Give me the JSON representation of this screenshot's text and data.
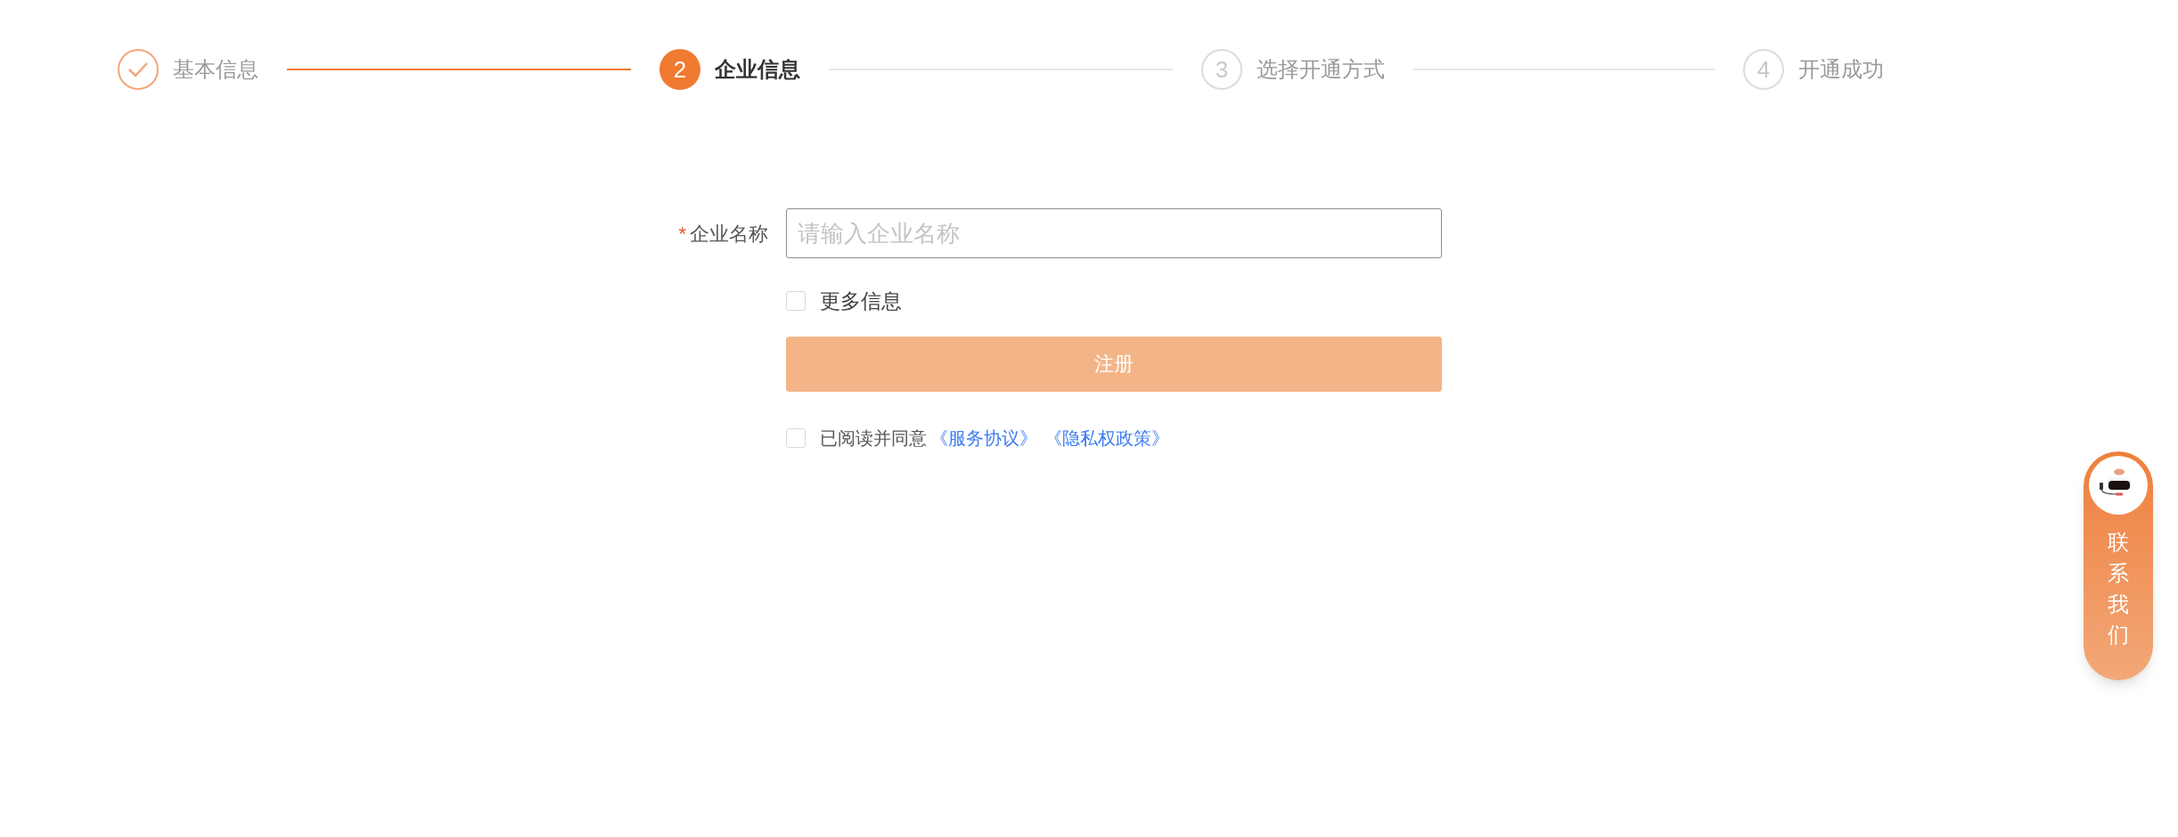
{
  "steps": [
    {
      "label": "基本信息",
      "done": true,
      "selected": false
    },
    {
      "number": "2",
      "label": "企业信息",
      "done": false,
      "selected": true
    },
    {
      "number": "3",
      "label": "选择开通方式",
      "done": false,
      "selected": false
    },
    {
      "number": "4",
      "label": "开通成功",
      "done": false,
      "selected": false
    }
  ],
  "form": {
    "company_name": {
      "label": "企业名称",
      "required_mark": "*",
      "placeholder": "请输入企业名称"
    },
    "more_info": {
      "label": "更多信息",
      "checked": false
    },
    "submit": {
      "label": "注册",
      "disabled": true
    },
    "agreement": {
      "checked": false,
      "text": "已阅读并同意",
      "links": [
        "《服务协议》",
        "《隐私权政策》"
      ]
    }
  },
  "contact": {
    "label": "联系我们"
  }
}
